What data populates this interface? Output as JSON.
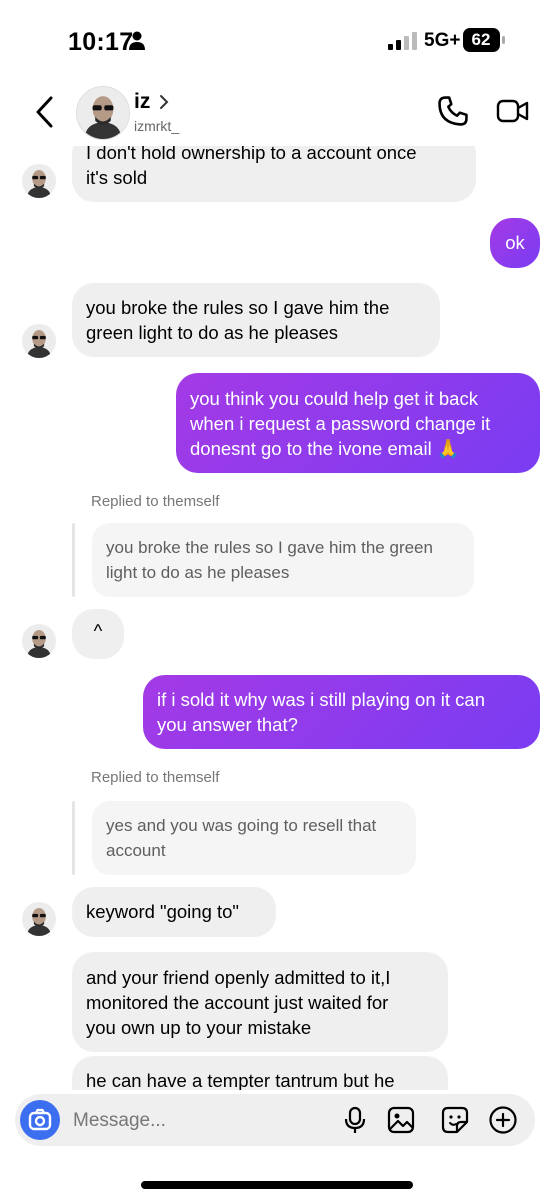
{
  "status_bar": {
    "time": "10:17",
    "network": "5G+",
    "battery": "62"
  },
  "header": {
    "name": "iz",
    "username": "izmrkt_"
  },
  "messages": [
    {
      "side": "in",
      "text_lines": [
        "I don't hold ownership to a account once",
        "it's sold"
      ]
    },
    {
      "side": "out",
      "text_lines": [
        "ok"
      ]
    },
    {
      "side": "in",
      "text_lines": [
        "you broke the rules so I gave him the",
        "green light to do as he pleases"
      ]
    },
    {
      "side": "out",
      "text_lines": [
        "you think you could help get it back",
        "when i request a password change it",
        "donesnt go to the ivone email 🙏"
      ]
    },
    {
      "reply_label": "Replied to themself",
      "quoted_lines": [
        "you broke the rules so I gave him the green",
        "light to do as he pleases"
      ],
      "side": "in",
      "text_lines": [
        "^"
      ]
    },
    {
      "side": "out",
      "text_lines": [
        "if i sold it why was i still playing on it can",
        "you answer that?"
      ]
    },
    {
      "reply_label": "Replied to themself",
      "quoted_lines": [
        "yes and you was going to resell that",
        "account"
      ],
      "side": "in",
      "text_lines": [
        "keyword \"going to\""
      ]
    },
    {
      "side": "in",
      "text_lines": [
        "and your friend openly admitted to it,I",
        "monitored the account just waited for",
        "you own up to your mistake"
      ]
    },
    {
      "side": "in",
      "text_lines": [
        "he can have a tempter tantrum but he"
      ]
    }
  ],
  "composer": {
    "placeholder": "Message..."
  },
  "colors": {
    "outgoing_start": "#a43ae6",
    "outgoing_end": "#7a3cf2",
    "incoming": "#efefef",
    "camera": "#3b6ff0"
  },
  "icons": [
    "person-icon",
    "signal-icon",
    "back-icon",
    "chevron-right-icon",
    "phone-icon",
    "video-icon",
    "camera-icon",
    "mic-icon",
    "gallery-icon",
    "sticker-icon",
    "plus-icon"
  ]
}
